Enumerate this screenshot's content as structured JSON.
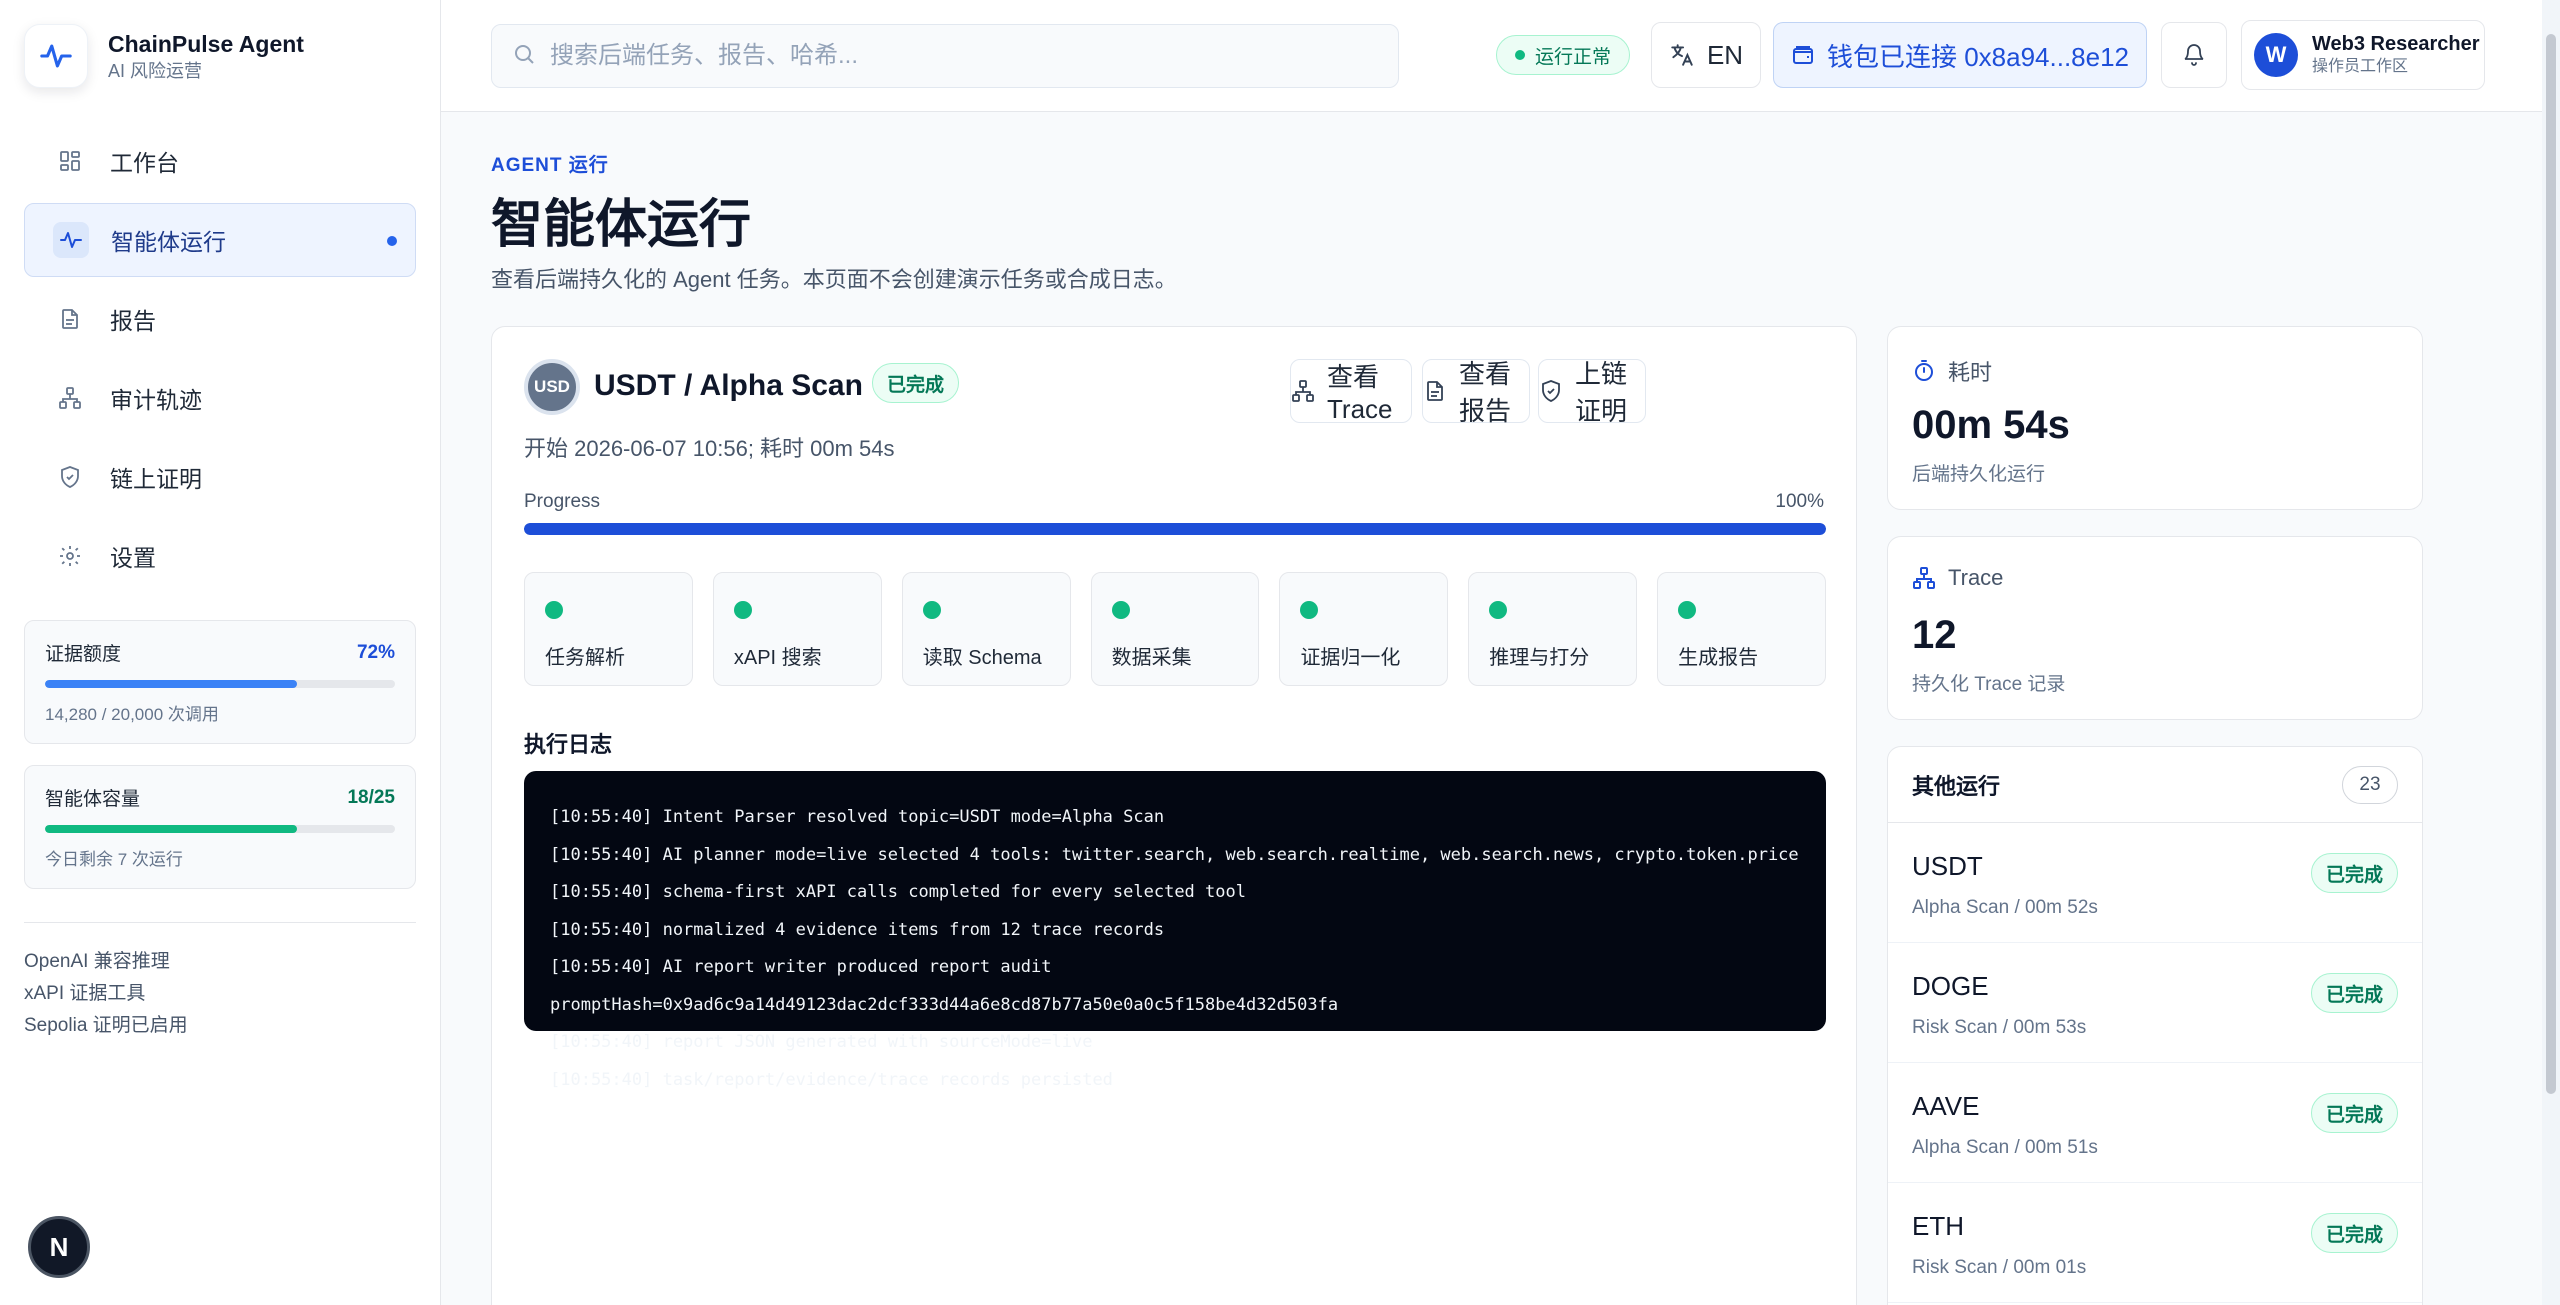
{
  "brand": {
    "title": "ChainPulse Agent",
    "subtitle": "AI 风险运营"
  },
  "nav": {
    "items": [
      {
        "label": "工作台",
        "icon": "grid-icon"
      },
      {
        "label": "智能体运行",
        "icon": "activity-icon"
      },
      {
        "label": "报告",
        "icon": "file-icon"
      },
      {
        "label": "审计轨迹",
        "icon": "network-icon"
      },
      {
        "label": "链上证明",
        "icon": "shield-icon"
      },
      {
        "label": "设置",
        "icon": "gear-icon"
      }
    ],
    "active_index": 1
  },
  "quota": {
    "evidence": {
      "label": "证据额度",
      "value": "72%",
      "percent": 72,
      "sub": "14,280 / 20,000 次调用",
      "color": "#3b82f6"
    },
    "capacity": {
      "label": "智能体容量",
      "value": "18/25",
      "percent": 72,
      "sub": "今日剩余 7 次运行",
      "color": "#10b981"
    }
  },
  "side_notes": [
    "OpenAI 兼容推理",
    "xAPI 证据工具",
    "Sepolia 证明已启用"
  ],
  "next_badge": "N",
  "topbar": {
    "search_placeholder": "搜索后端任务、报告、哈希...",
    "status": "运行正常",
    "lang": "EN",
    "wallet": "钱包已连接 0x8a94...8e12",
    "user": {
      "initial": "W",
      "name": "Web3 Researcher",
      "role": "操作员工作区"
    }
  },
  "page": {
    "eyebrow": "AGENT 运行",
    "title": "智能体运行",
    "description": "查看后端持久化的 Agent 任务。本页面不会创建演示任务或合成日志。"
  },
  "run": {
    "coin": "USD",
    "title": "USDT / Alpha Scan",
    "status": "已完成",
    "meta": "开始 2026-06-07 10:56; 耗时 00m 54s",
    "actions": {
      "trace": "查看 Trace",
      "report": "查看报告",
      "proof": "上链证明"
    },
    "progress_label": "Progress",
    "progress_text": "100%",
    "progress_percent": 100,
    "steps": [
      "任务解析",
      "xAPI 搜索",
      "读取 Schema",
      "数据采集",
      "证据归一化",
      "推理与打分",
      "生成报告"
    ],
    "log_title": "执行日志",
    "log": [
      "[10:55:40] Intent Parser resolved topic=USDT mode=Alpha Scan",
      "[10:55:40] AI planner mode=live selected 4 tools: twitter.search, web.search.realtime, web.search.news, crypto.token.price",
      "[10:55:40] schema-first xAPI calls completed for every selected tool",
      "[10:55:40] normalized 4 evidence items from 12 trace records",
      "[10:55:40] AI report writer produced report audit",
      "promptHash=0x9ad6c9a14d49123dac2dcf333d44a6e8cd87b77a50e0a0c5f158be4d32d503fa",
      "[10:55:40] report JSON generated with sourceMode=live",
      "[10:55:40] task/report/evidence/trace records persisted"
    ]
  },
  "stats": {
    "duration": {
      "label": "耗时",
      "value": "00m 54s",
      "sub": "后端持久化运行"
    },
    "trace": {
      "label": "Trace",
      "value": "12",
      "sub": "持久化 Trace 记录"
    }
  },
  "other_runs": {
    "title": "其他运行",
    "count": "23",
    "items": [
      {
        "name": "USDT",
        "sub": "Alpha Scan / 00m 52s",
        "status": "已完成"
      },
      {
        "name": "DOGE",
        "sub": "Risk Scan / 00m 53s",
        "status": "已完成"
      },
      {
        "name": "AAVE",
        "sub": "Alpha Scan / 00m 51s",
        "status": "已完成"
      },
      {
        "name": "ETH",
        "sub": "Risk Scan / 00m 01s",
        "status": "已完成"
      }
    ]
  },
  "colors": {
    "accent": "#1d4ed8",
    "success": "#10b981",
    "success_text": "#047857"
  }
}
